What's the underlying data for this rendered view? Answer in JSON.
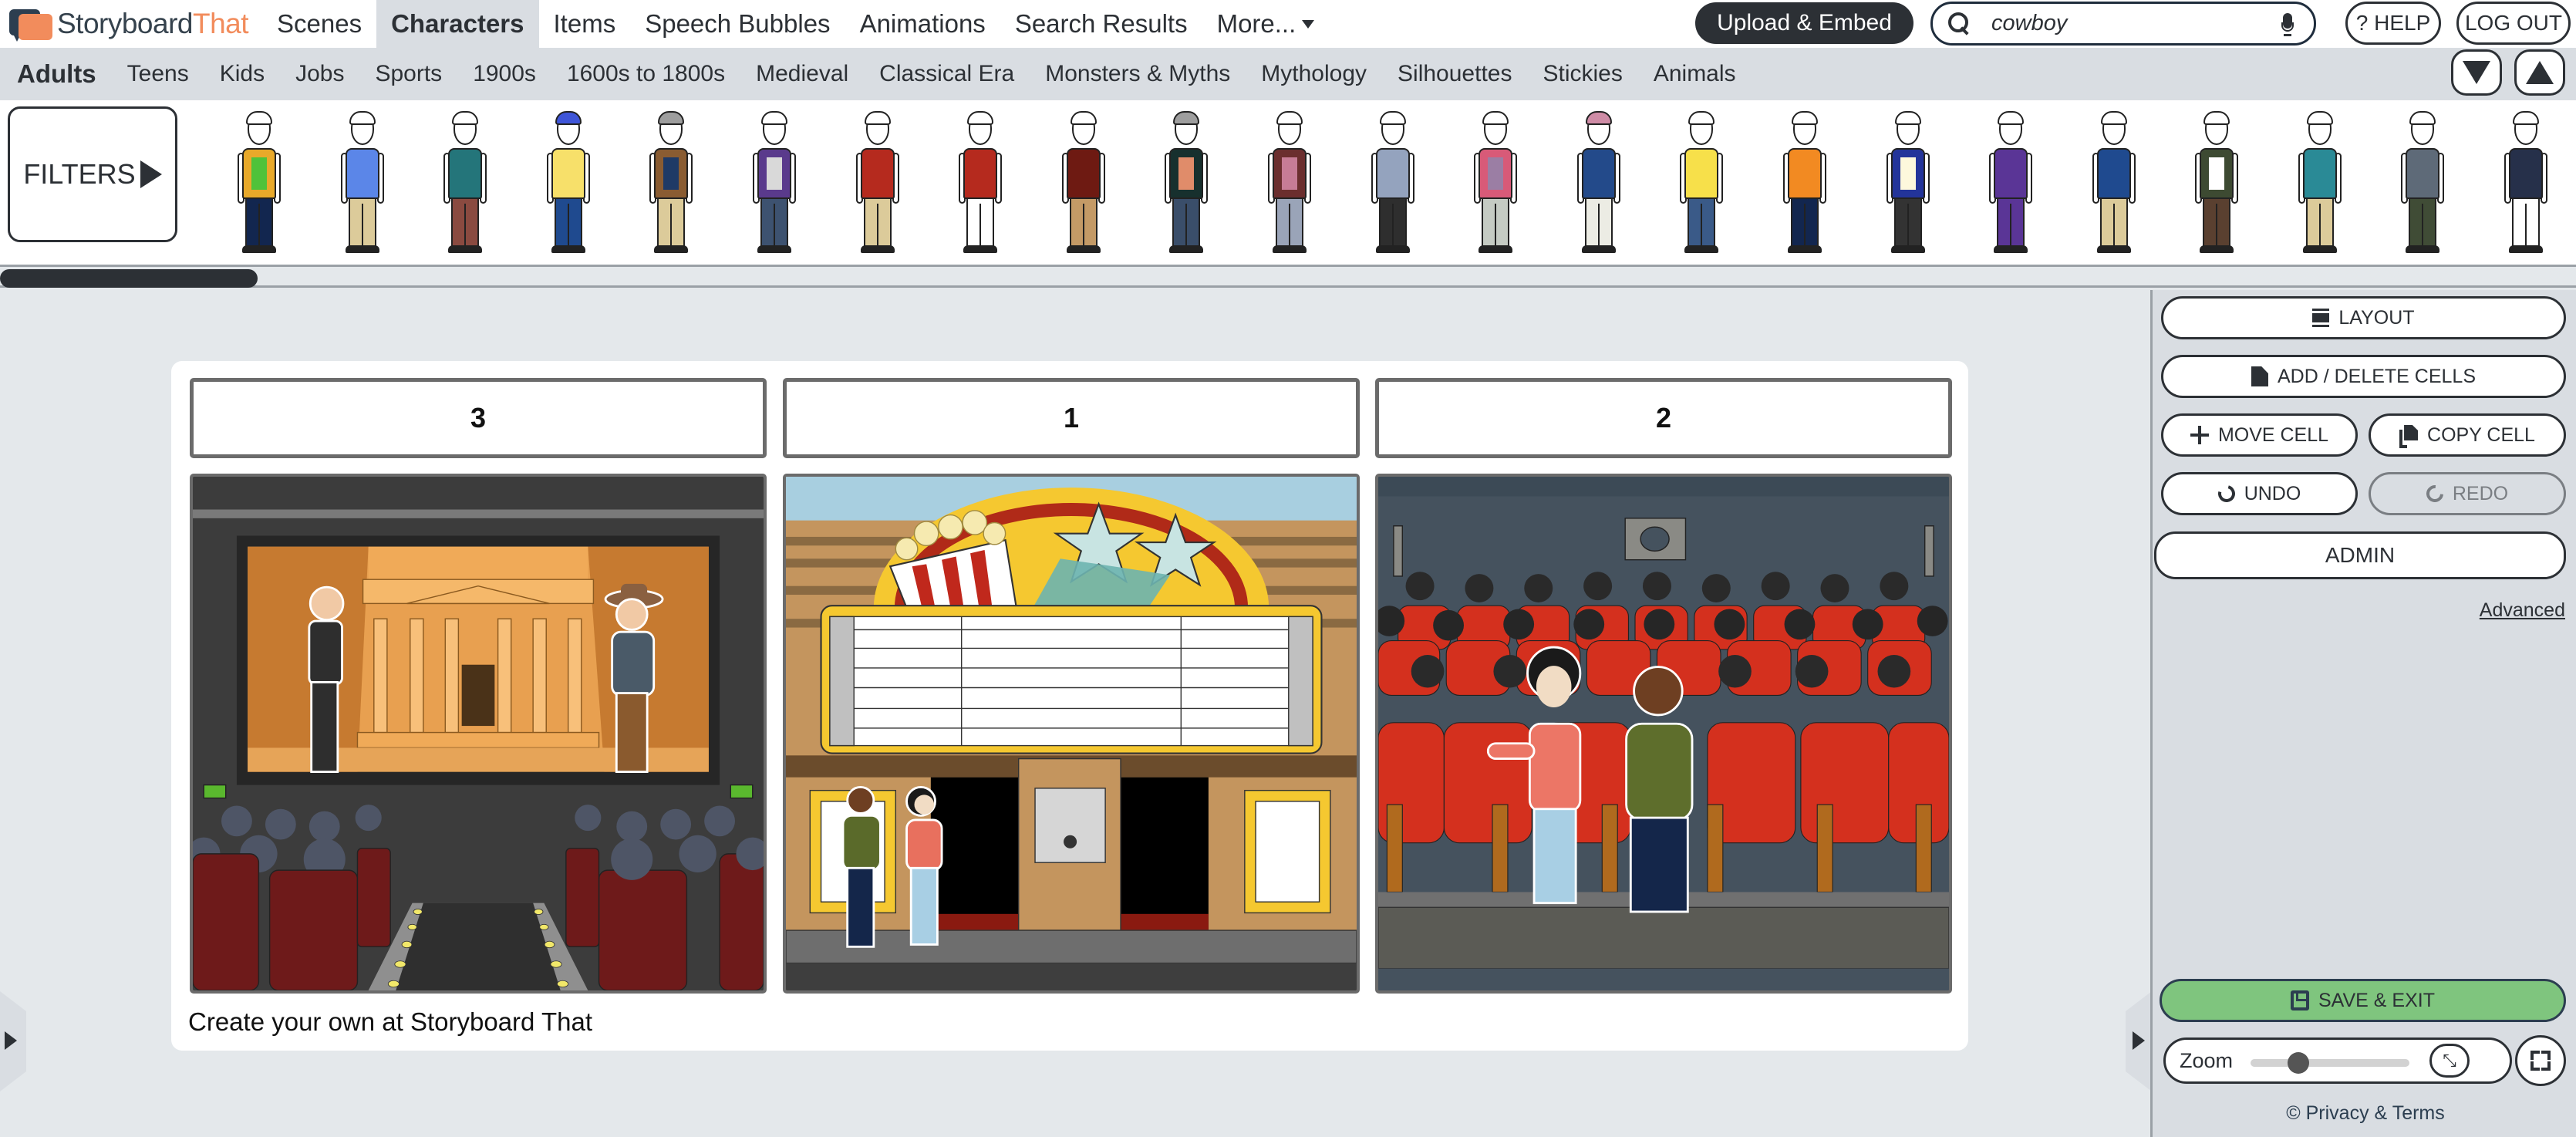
{
  "brand": {
    "name_part1": "Storyboard",
    "name_part2": "That",
    "accent": "#f28c5c",
    "dark": "#2c3e50"
  },
  "topnav": {
    "tabs": [
      {
        "label": "Scenes",
        "active": false
      },
      {
        "label": "Characters",
        "active": true
      },
      {
        "label": "Items",
        "active": false
      },
      {
        "label": "Speech Bubbles",
        "active": false
      },
      {
        "label": "Animations",
        "active": false
      },
      {
        "label": "Search Results",
        "active": false
      },
      {
        "label": "More...",
        "active": false,
        "has_dropdown": true
      }
    ],
    "upload_embed_label": "Upload & Embed",
    "search": {
      "value": "cowboy",
      "icon": "search-icon",
      "mic_icon": "microphone-icon"
    },
    "help_label": "? HELP",
    "logout_label": "LOG OUT"
  },
  "categories": {
    "items": [
      "Adults",
      "Teens",
      "Kids",
      "Jobs",
      "Sports",
      "1900s",
      "1600s to 1800s",
      "Medieval",
      "Classical Era",
      "Monsters & Myths",
      "Mythology",
      "Silhouettes",
      "Stickies",
      "Animals"
    ],
    "active": "Adults",
    "collapse_icon": "triangle-down-icon",
    "expand_icon": "triangle-up-icon"
  },
  "character_strip": {
    "filters_label": "FILTERS",
    "characters": [
      {
        "top": "#e8a92a",
        "inner": "#4fc23a",
        "bottom": "#12264f",
        "hair": "#ffffff"
      },
      {
        "top": "#5b86e8",
        "inner": "#5b86e8",
        "bottom": "#dccb9a",
        "hair": "#ffffff"
      },
      {
        "top": "#24757a",
        "inner": "#24757a",
        "bottom": "#8a4a40",
        "hair": "#ffffff"
      },
      {
        "top": "#f7e06a",
        "inner": "#f7e06a",
        "bottom": "#1f4a8f",
        "hair": "#3e55d8"
      },
      {
        "top": "#8a5c32",
        "inner": "#1f3a66",
        "bottom": "#dccb9a",
        "hair": "#9e9e9e"
      },
      {
        "top": "#5a3a8c",
        "inner": "#d9d9d9",
        "bottom": "#3d5270",
        "hair": "#ffffff"
      },
      {
        "top": "#b52a1e",
        "inner": "#b52a1e",
        "bottom": "#dccb9a",
        "hair": "#ffffff"
      },
      {
        "top": "#b52a1e",
        "inner": "#b52a1e",
        "bottom": "#ffffff",
        "hair": "#ffffff"
      },
      {
        "top": "#6e1a12",
        "inner": "#6e1a12",
        "bottom": "#c49a66",
        "hair": "#ffffff"
      },
      {
        "top": "#17302e",
        "inner": "#e08c6a",
        "bottom": "#3a4e6a",
        "hair": "#9e9e9e"
      },
      {
        "top": "#6b2e2e",
        "inner": "#c77c96",
        "bottom": "#9aa4b8",
        "hair": "#ffffff"
      },
      {
        "top": "#94a3be",
        "inner": "#94a3be",
        "bottom": "#2e2e2e",
        "hair": "#ffffff"
      },
      {
        "top": "#d85a78",
        "inner": "#9b7ea4",
        "bottom": "#c5cbc3",
        "hair": "#ffffff"
      },
      {
        "top": "#234a8a",
        "inner": "#234a8a",
        "bottom": "#ecece4",
        "hair": "#cf8ca6"
      },
      {
        "top": "#f7e04a",
        "inner": "#f7e04a",
        "bottom": "#3a5a88",
        "hair": "#ffffff"
      },
      {
        "top": "#f28a22",
        "inner": "#f28a22",
        "bottom": "#12264f",
        "hair": "#ffffff"
      },
      {
        "top": "#23349a",
        "inner": "#fdf8dc",
        "bottom": "#333333",
        "hair": "#ffffff"
      },
      {
        "top": "#5a3596",
        "inner": "#5a3596",
        "bottom": "#5a3596",
        "hair": "#ffffff"
      },
      {
        "top": "#1f4a8f",
        "inner": "#1f4a8f",
        "bottom": "#dccb9a",
        "hair": "#ffffff"
      },
      {
        "top": "#3d4a32",
        "inner": "#ffffff",
        "bottom": "#5a4030",
        "hair": "#ffffff"
      },
      {
        "top": "#2a8a96",
        "inner": "#2a8a96",
        "bottom": "#dccb9a",
        "hair": "#ffffff"
      },
      {
        "top": "#5e6a78",
        "inner": "#5e6a78",
        "bottom": "#404c36",
        "hair": "#ffffff"
      },
      {
        "top": "#26304a",
        "inner": "#26304a",
        "bottom": "#ffffff",
        "hair": "#ffffff"
      }
    ]
  },
  "storyboard": {
    "cells": [
      {
        "title": "3",
        "scene": "movie-theater-screen-petra",
        "description": "Theater audience watching a film with a bearded man in a suit and a cowboy in front of an ancient temple"
      },
      {
        "title": "1",
        "scene": "movie-theater-marquee",
        "description": "Two teens standing outside a movie theater with a popcorn and stars marquee"
      },
      {
        "title": "2",
        "scene": "theater-seats",
        "description": "Two teens sitting in red theater seats in front of a silhouetted audience"
      }
    ],
    "caption": "Create your own at Storyboard That"
  },
  "right_panel": {
    "layout_label": "LAYOUT",
    "add_delete_label": "ADD / DELETE CELLS",
    "move_cell_label": "MOVE CELL",
    "copy_cell_label": "COPY CELL",
    "undo_label": "UNDO",
    "redo_label": "REDO",
    "redo_disabled": true,
    "admin_label": "ADMIN",
    "advanced_label": "Advanced",
    "save_exit_label": "SAVE & EXIT",
    "save_color": "#7fc57e",
    "zoom_label": "Zoom",
    "zoom_value": 0.3,
    "privacy_label": "© Privacy & Terms"
  },
  "horizontal_scroll": {
    "position": 0.0,
    "visible_fraction": 0.1
  }
}
